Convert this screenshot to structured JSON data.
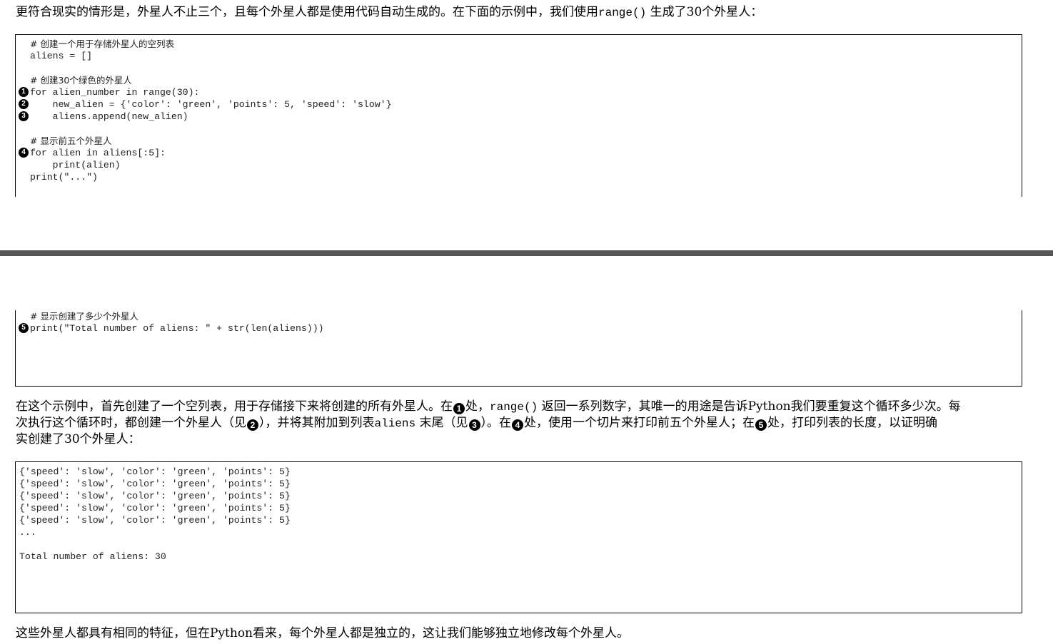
{
  "intro": {
    "part1": "更符合现实的情形是，外星人不止三个，且每个外星人都是使用代码自动生成的。在下面的示例中，我们使用",
    "code": "range()",
    "part2": " 生成了30个外星人："
  },
  "code_block_1": [
    {
      "marker": "",
      "text": "# 创建一个用于存储外星人的空列表"
    },
    {
      "marker": "",
      "text": "aliens = []"
    },
    {
      "marker": "",
      "text": ""
    },
    {
      "marker": "",
      "text": "# 创建30个绿色的外星人"
    },
    {
      "marker": "1",
      "text": "for alien_number in range(30):"
    },
    {
      "marker": "2",
      "text": "    new_alien = {'color': 'green', 'points': 5, 'speed': 'slow'}"
    },
    {
      "marker": "3",
      "text": "    aliens.append(new_alien)"
    },
    {
      "marker": "",
      "text": ""
    },
    {
      "marker": "",
      "text": "# 显示前五个外星人"
    },
    {
      "marker": "4",
      "text": "for alien in aliens[:5]:"
    },
    {
      "marker": "",
      "text": "    print(alien)"
    },
    {
      "marker": "",
      "text": "print(\"...\")"
    }
  ],
  "code_block_2": [
    {
      "marker": "",
      "text": "# 显示创建了多少个外星人"
    },
    {
      "marker": "5",
      "text": "print(\"Total number of aliens: \" + str(len(aliens)))"
    }
  ],
  "explanation": {
    "l1_a": "在这个示例中，首先创建了一个空列表，用于存储接下来将创建的所有外星人。在",
    "m1": "1",
    "l1_b": "处，",
    "l1_code": "range()",
    "l1_c": " 返回一系列数字，其唯一的用途是告诉Python我们要重复这个循环多少次。每",
    "l2_a": "次执行这个循环时，都创建一个外星人（见",
    "m2": "2",
    "l2_b": "），并将其附加到列表",
    "l2_code": "aliens",
    "l2_c": " 末尾（见",
    "m3": "3",
    "l2_d": "）。在",
    "m4": "4",
    "l2_e": "处，使用一个切片来打印前五个外星人；在",
    "m5": "5",
    "l2_f": "处，打印列表的长度，以证明确",
    "l3": "实创建了30个外星人："
  },
  "output_block": [
    "{'speed': 'slow', 'color': 'green', 'points': 5}",
    "{'speed': 'slow', 'color': 'green', 'points': 5}",
    "{'speed': 'slow', 'color': 'green', 'points': 5}",
    "{'speed': 'slow', 'color': 'green', 'points': 5}",
    "{'speed': 'slow', 'color': 'green', 'points': 5}",
    "...",
    "",
    "Total number of aliens: 30"
  ],
  "conclusion": "这些外星人都具有相同的特征，但在Python看来，每个外星人都是独立的，这让我们能够独立地修改每个外星人。"
}
